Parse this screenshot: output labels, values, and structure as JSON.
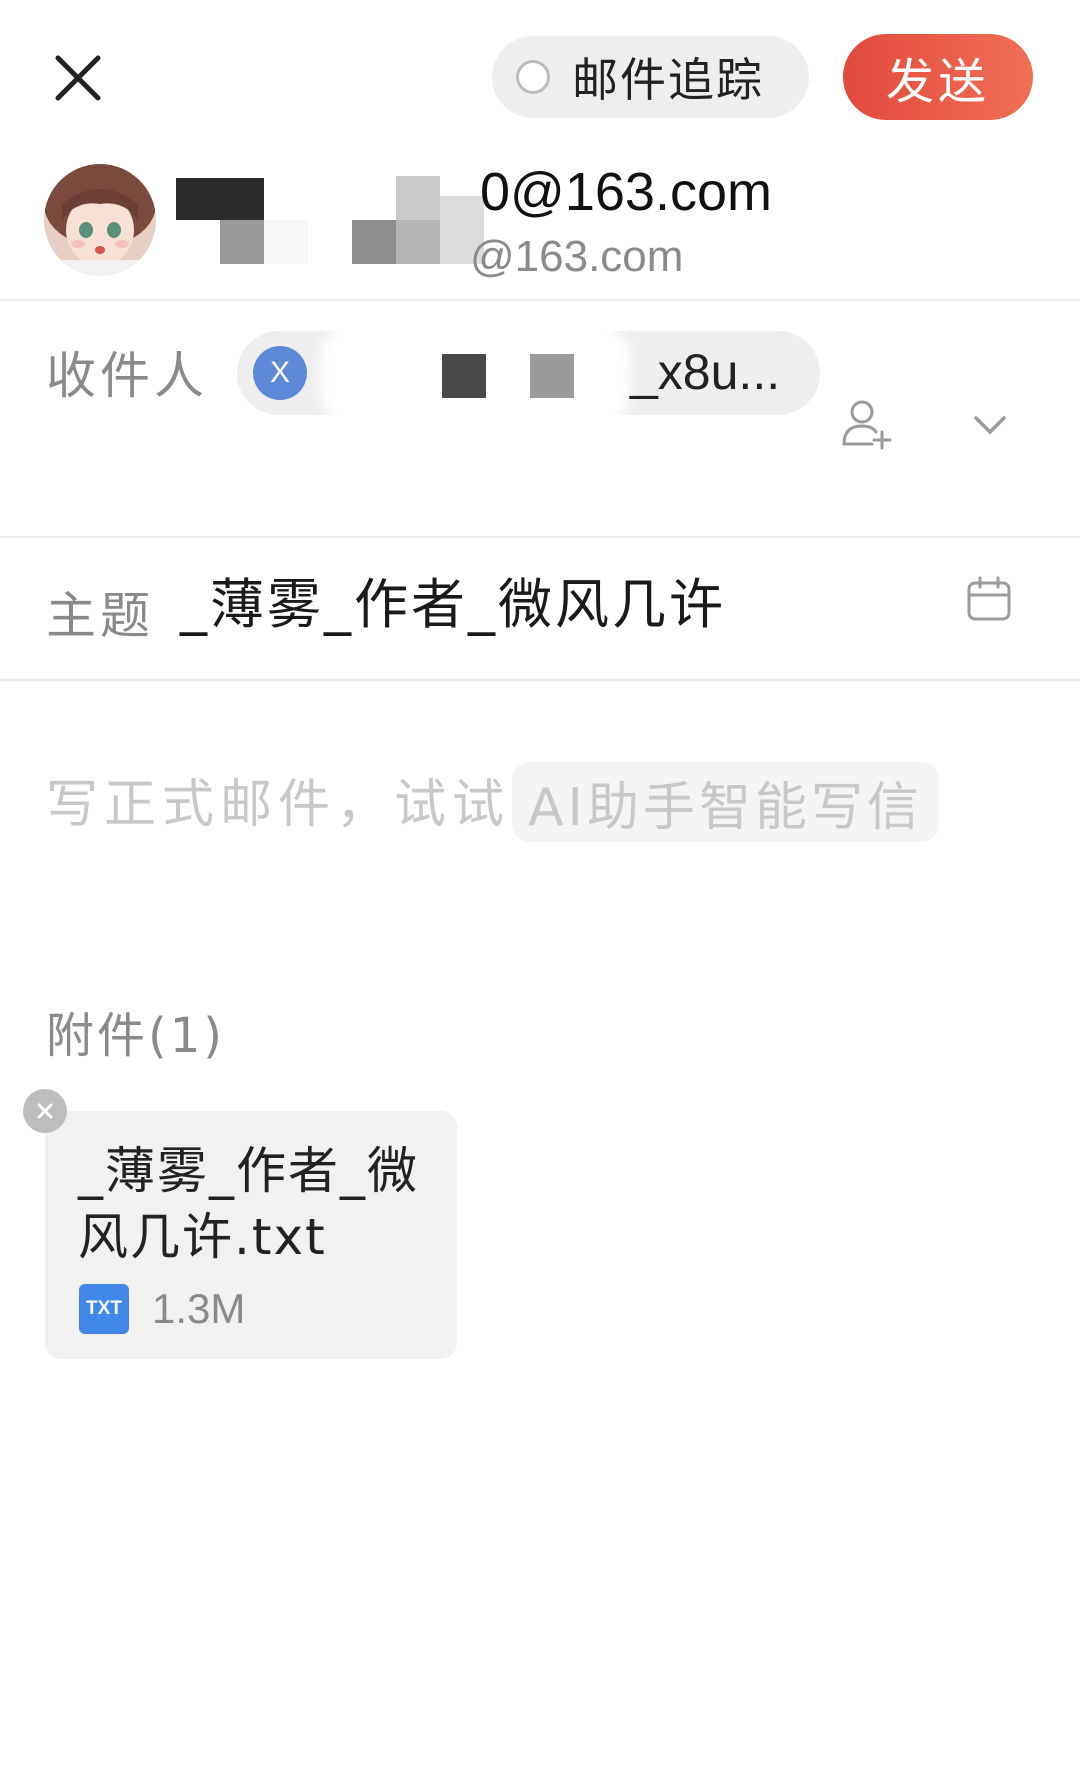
{
  "top_bar": {
    "track_label": "邮件追踪",
    "send_label": "发送"
  },
  "sender": {
    "email_visible": "0@163.com",
    "alias_visible": "@163.com"
  },
  "recipients": {
    "label": "收件人",
    "chip_initial": "X",
    "chip_text_visible": "_x8u..."
  },
  "subject": {
    "label": "主题",
    "value": "_薄雾_作者_微风几许"
  },
  "body": {
    "placeholder": "写正式邮件，试试",
    "ai_suggestion": "AI助手智能写信"
  },
  "attachments": {
    "heading": "附件(1)",
    "items": [
      {
        "name": "_薄雾_作者_微风几许.txt",
        "type_badge": "TXT",
        "size": "1.3M"
      }
    ]
  },
  "colors": {
    "send_button": "#e8523f",
    "chip_avatar": "#5d8ad8",
    "file_badge": "#3f87e8"
  }
}
